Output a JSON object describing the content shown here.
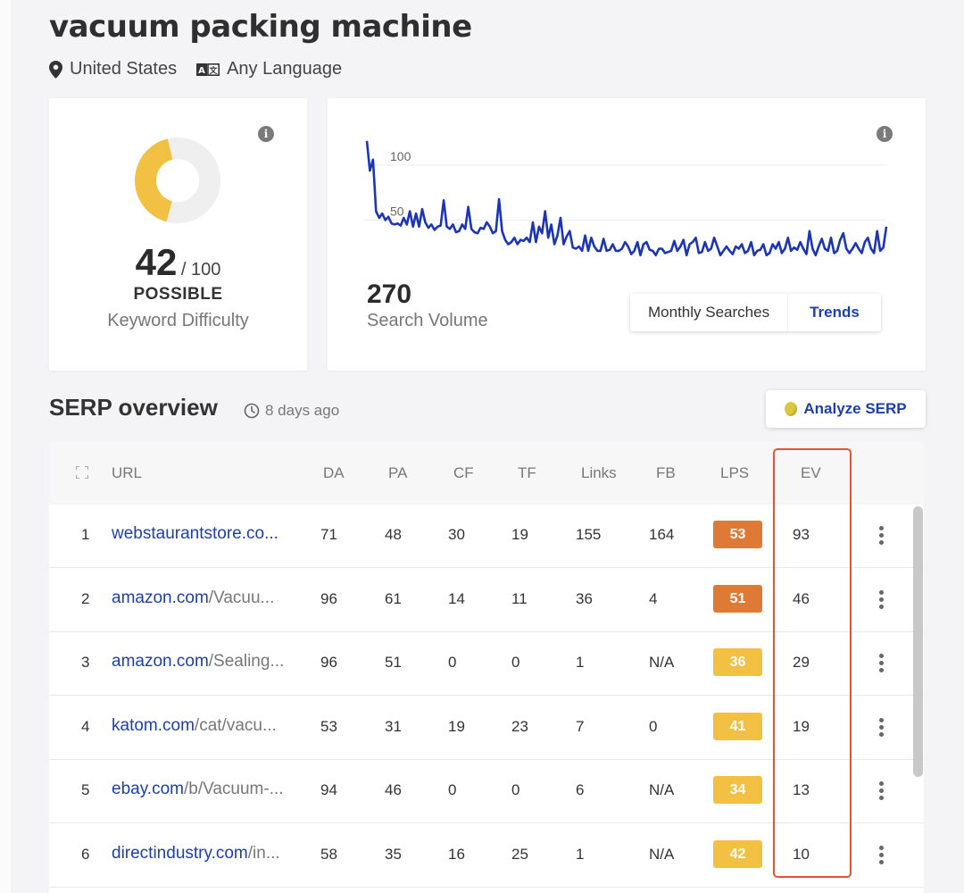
{
  "keyword": "vacuum packing machine",
  "location": {
    "icon": "map-pin-icon",
    "label": "United States"
  },
  "language": {
    "icon": "translate-icon",
    "label": "Any Language"
  },
  "keyword_difficulty": {
    "value": "42",
    "max": "/ 100",
    "level": "POSSIBLE",
    "caption": "Keyword Difficulty",
    "score": 42,
    "color": "#f2c144",
    "track_color": "#efefef"
  },
  "search_volume": {
    "value": "270",
    "caption": "Search Volume",
    "tabs": [
      {
        "label": "Monthly Searches",
        "active": false
      },
      {
        "label": "Trends",
        "active": true
      }
    ],
    "line_color": "#1c35b8"
  },
  "chart_data": {
    "type": "line",
    "title": "",
    "xlabel": "",
    "ylabel": "",
    "ytick_labels": [
      "100",
      "50"
    ],
    "ylim": [
      0,
      130
    ],
    "grid": true,
    "series": [
      {
        "values": [
          122,
          95,
          105,
          58,
          52,
          56,
          50,
          53,
          47,
          46,
          47,
          45,
          52,
          46,
          58,
          44,
          56,
          44,
          60,
          48,
          43,
          46,
          41,
          44,
          45,
          68,
          44,
          42,
          46,
          39,
          40,
          46,
          42,
          62,
          42,
          39,
          38,
          43,
          42,
          48,
          44,
          38,
          40,
          69,
          40,
          32,
          28,
          30,
          34,
          28,
          32,
          31,
          34,
          30,
          48,
          30,
          44,
          38,
          58,
          34,
          46,
          28,
          36,
          52,
          28,
          35,
          40,
          25,
          24,
          26,
          22,
          36,
          22,
          34,
          26,
          22,
          22,
          33,
          22,
          23,
          28,
          22,
          22,
          24,
          30,
          26,
          19,
          22,
          30,
          18,
          28,
          30,
          23,
          22,
          18,
          24,
          24,
          20,
          21,
          22,
          31,
          22,
          26,
          32,
          18,
          28,
          30,
          34,
          20,
          21,
          30,
          22,
          24,
          34,
          26,
          18,
          22,
          26,
          22,
          19,
          26,
          24,
          28,
          20,
          22,
          30,
          18,
          22,
          23,
          28,
          18,
          20,
          28,
          24,
          30,
          20,
          24,
          34,
          22,
          25,
          23,
          30,
          24,
          19,
          40,
          24,
          18,
          26,
          33,
          24,
          22,
          34,
          20,
          22,
          32,
          38,
          24,
          20,
          24,
          29,
          24,
          20,
          30,
          34,
          24,
          20,
          40,
          22,
          25,
          44
        ]
      }
    ]
  },
  "serp": {
    "title": "SERP overview",
    "age": "8 days ago",
    "analyze_label": "Analyze SERP",
    "headers": [
      "URL",
      "DA",
      "PA",
      "CF",
      "TF",
      "Links",
      "FB",
      "LPS",
      "EV"
    ],
    "rows": [
      {
        "rank": "1",
        "domain": "webstaurantstore.co...",
        "path": "",
        "da": "71",
        "pa": "48",
        "cf": "30",
        "tf": "19",
        "links": "155",
        "fb": "164",
        "lps": "53",
        "lps_color": "#dd7a35",
        "ev": "93"
      },
      {
        "rank": "2",
        "domain": "amazon.com",
        "path": "/Vacuu...",
        "da": "96",
        "pa": "61",
        "cf": "14",
        "tf": "11",
        "links": "36",
        "fb": "4",
        "lps": "51",
        "lps_color": "#dd7a35",
        "ev": "46"
      },
      {
        "rank": "3",
        "domain": "amazon.com",
        "path": "/Sealing...",
        "da": "96",
        "pa": "51",
        "cf": "0",
        "tf": "0",
        "links": "1",
        "fb": "N/A",
        "lps": "36",
        "lps_color": "#f2c144",
        "ev": "29"
      },
      {
        "rank": "4",
        "domain": "katom.com",
        "path": "/cat/vacu...",
        "da": "53",
        "pa": "31",
        "cf": "19",
        "tf": "23",
        "links": "7",
        "fb": "0",
        "lps": "41",
        "lps_color": "#f2c144",
        "ev": "19"
      },
      {
        "rank": "5",
        "domain": "ebay.com",
        "path": "/b/Vacuum-...",
        "da": "94",
        "pa": "46",
        "cf": "0",
        "tf": "0",
        "links": "6",
        "fb": "N/A",
        "lps": "34",
        "lps_color": "#f2c144",
        "ev": "13"
      },
      {
        "rank": "6",
        "domain": "directindustry.com",
        "path": "/in...",
        "da": "58",
        "pa": "35",
        "cf": "16",
        "tf": "25",
        "links": "1",
        "fb": "N/A",
        "lps": "42",
        "lps_color": "#f2c144",
        "ev": "10"
      }
    ]
  },
  "highlight_color": "#e4542e"
}
